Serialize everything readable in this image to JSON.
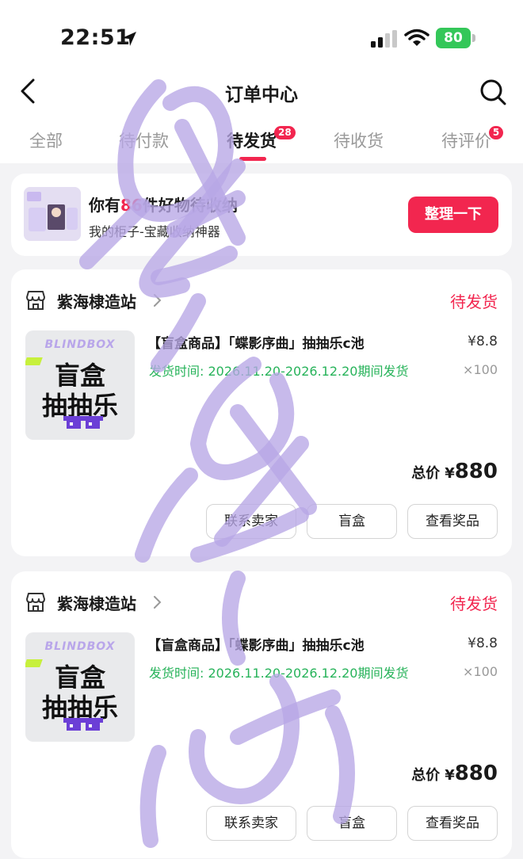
{
  "status_bar": {
    "time": "22:51",
    "battery": "80"
  },
  "nav": {
    "title": "订单中心"
  },
  "tabs": [
    {
      "label": "全部",
      "badge": ""
    },
    {
      "label": "待付款",
      "badge": ""
    },
    {
      "label": "待发货",
      "badge": "28",
      "active": true
    },
    {
      "label": "待收货",
      "badge": ""
    },
    {
      "label": "待评价",
      "badge": "5"
    }
  ],
  "promo": {
    "line1_prefix": "你有",
    "count": "86",
    "line1_suffix": "件好物待收纳",
    "line2": "我的柜子-宝藏收纳神器",
    "button": "整理一下"
  },
  "orders": [
    {
      "shop": "紫海棣造站",
      "status": "待发货",
      "thumb": {
        "brand": "BLINDBOX",
        "line1": "盲盒",
        "line2": "抽抽乐"
      },
      "title": "【盲盒商品】「蝶影序曲」抽抽乐c池",
      "ship": "发货时间: 2026.11.20-2026.12.20期间发货",
      "price": "¥8.8",
      "qty": "×100",
      "total_label": "总价",
      "total_yen": "¥",
      "total_amount": "880",
      "buttons": [
        "联系卖家",
        "盲盒",
        "查看奖品"
      ]
    },
    {
      "shop": "紫海棣造站",
      "status": "待发货",
      "thumb": {
        "brand": "BLINDBOX",
        "line1": "盲盒",
        "line2": "抽抽乐"
      },
      "title": "【盲盒商品】「蝶影序曲」抽抽乐c池",
      "ship": "发货时间: 2026.11.20-2026.12.20期间发货",
      "price": "¥8.8",
      "qty": "×100",
      "total_label": "总价",
      "total_yen": "¥",
      "total_amount": "880",
      "buttons": [
        "联系卖家",
        "盲盒",
        "查看奖品"
      ]
    }
  ],
  "colors": {
    "accent": "#f2264f",
    "ship_green": "#27b35a",
    "watermark": "#b7a6e6"
  },
  "icons": [
    "location-arrow-icon",
    "signal-icon",
    "wifi-icon",
    "battery-icon",
    "back-icon",
    "search-icon",
    "shop-icon",
    "chevron-right-icon"
  ]
}
